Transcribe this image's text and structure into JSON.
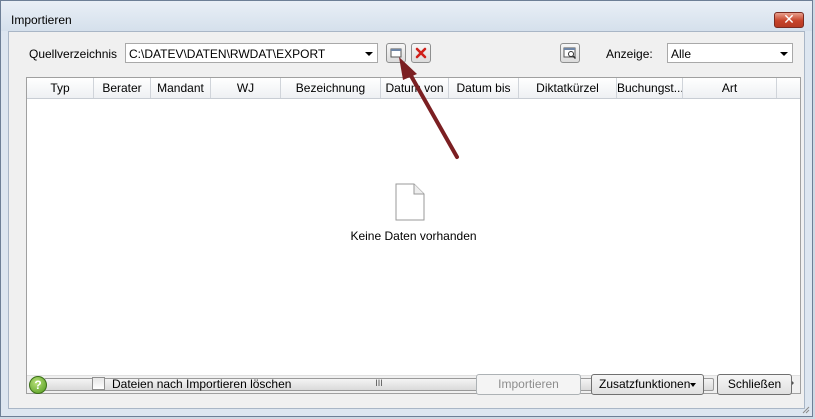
{
  "window": {
    "title": "Importieren",
    "close_icon": "close-icon"
  },
  "toolbar": {
    "source_label": "Quellverzeichnis",
    "source_value": "C:\\DATEV\\DATEN\\RWDAT\\EXPORT",
    "browse_icon": "folder-browse-icon",
    "remove_icon": "delete-x-icon",
    "preview_icon": "search-preview-icon",
    "display_label": "Anzeige:",
    "display_value": "Alle"
  },
  "table": {
    "columns": [
      "Typ",
      "Berater",
      "Mandant",
      "WJ",
      "Bezeichnung",
      "Datum von",
      "Datum bis",
      "Diktatkürzel",
      "Buchungst...",
      "Art"
    ],
    "rows": [],
    "empty_text": "Keine Daten vorhanden",
    "empty_icon": "blank-document-icon",
    "scroll_grip": "III"
  },
  "footer": {
    "help_icon": "help-icon",
    "help_glyph": "?",
    "checkbox_label": "Dateien nach Importieren löschen",
    "checkbox_checked": false,
    "import_button": "Importieren",
    "extra_button": "Zusatzfunktionen",
    "close_button": "Schließen"
  },
  "colors": {
    "close_red": "#c7432a",
    "arrow_annotation": "#7b1f22",
    "help_green": "#4f9a1b"
  }
}
